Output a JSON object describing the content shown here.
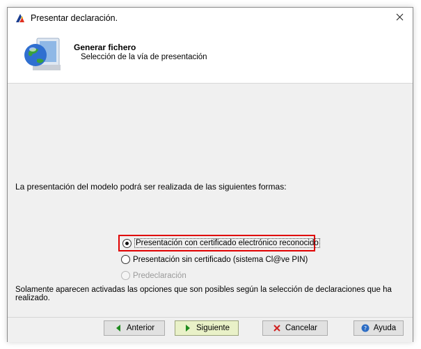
{
  "window": {
    "title": "Presentar declaración."
  },
  "header": {
    "title": "Generar fichero",
    "subtitle": "Selección de la vía de presentación"
  },
  "main": {
    "intro": "La presentación del modelo podrá ser realizada de las siguientes formas:",
    "options": [
      {
        "label": "Presentación con certificado electrónico reconocido",
        "selected": true,
        "enabled": true
      },
      {
        "label": "Presentación sin certificado (sistema Cl@ve PIN)",
        "selected": false,
        "enabled": true
      },
      {
        "label": "Predeclaración",
        "selected": false,
        "enabled": false
      }
    ],
    "note": "Solamente aparecen activadas las opciones que son posibles según la selección de declaraciones que ha realizado."
  },
  "footer": {
    "back_label": "Anterior",
    "next_label": "Siguiente",
    "cancel_label": "Cancelar",
    "help_label": "Ayuda"
  },
  "colors": {
    "highlight_border": "#e00000",
    "primary_button": "#e9f1c8",
    "arrow_green": "#1e8a1e"
  }
}
